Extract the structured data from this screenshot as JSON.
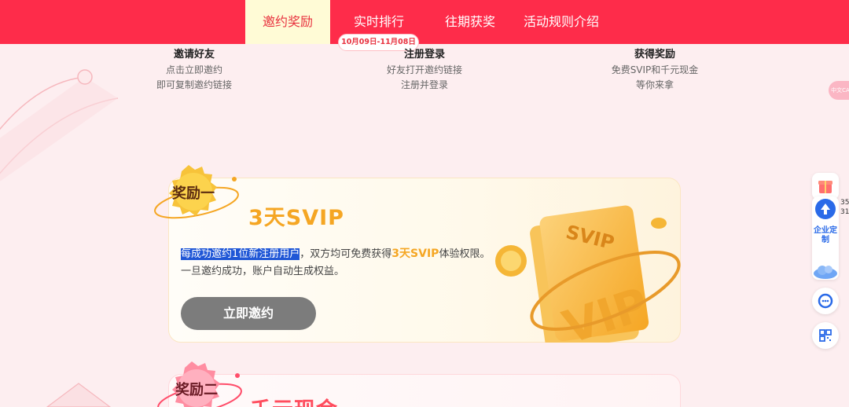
{
  "nav": {
    "tabs": [
      {
        "label": "邀约奖励",
        "active": true
      },
      {
        "label": "实时排行",
        "active": false
      },
      {
        "label": "往期获奖",
        "active": false
      },
      {
        "label": "活动规则介绍",
        "active": false
      }
    ],
    "date_range": "10月09日-11月08日"
  },
  "steps": [
    {
      "title": "邀请好友",
      "line1": "点击立即邀约",
      "line2": "即可复制邀约链接"
    },
    {
      "title": "注册登录",
      "line1": "好友打开邀约链接",
      "line2": "注册并登录"
    },
    {
      "title": "获得奖励",
      "line1": "免费SVIP和千元现金",
      "line2": "等你来拿"
    }
  ],
  "reward1": {
    "badge": "奖励一",
    "title": "3天SVIP",
    "desc_highlight": "每成功邀约1位新注册用户",
    "desc_mid": "，双方均可免费获得",
    "desc_em": "3天SVIP",
    "desc_end": "体验权限。",
    "desc_line2": "一旦邀约成功，账户自动生成权益。",
    "button": "立即邀约",
    "card_label": "SVIP",
    "card_big": "VIP"
  },
  "reward2": {
    "badge": "奖励二",
    "title": "千元现金"
  },
  "sidebar": {
    "tab_text": "中文CA",
    "enterprise": "企业定制",
    "num1": "35",
    "num2": "31"
  },
  "colors": {
    "nav_bg": "#fe2c4a",
    "active_tab_bg": "#fffbd6",
    "accent_gold": "#f5a623",
    "button_gray": "#7c7c7c"
  }
}
